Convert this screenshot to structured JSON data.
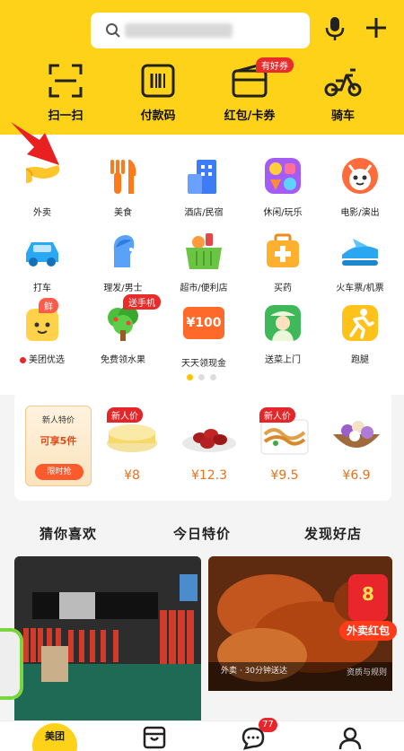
{
  "header": {
    "city": "",
    "quick_actions": [
      {
        "label": "扫一扫",
        "icon": "scan-icon"
      },
      {
        "label": "付款码",
        "icon": "barcode-icon"
      },
      {
        "label": "红包/卡券",
        "icon": "wallet-icon",
        "badge": "有好券"
      },
      {
        "label": "骑车",
        "icon": "scooter-icon"
      }
    ]
  },
  "grid": [
    {
      "label": "外卖",
      "icon": "takeout-icon"
    },
    {
      "label": "美食",
      "icon": "food-icon"
    },
    {
      "label": "酒店/民宿",
      "icon": "hotel-icon"
    },
    {
      "label": "休闲/玩乐",
      "icon": "leisure-icon"
    },
    {
      "label": "电影/演出",
      "icon": "movie-icon"
    },
    {
      "label": "打车",
      "icon": "taxi-icon"
    },
    {
      "label": "理发/男士",
      "icon": "barber-icon"
    },
    {
      "label": "超市/便利店",
      "icon": "supermarket-icon"
    },
    {
      "label": "买药",
      "icon": "medicine-icon"
    },
    {
      "label": "火车票/机票",
      "icon": "train-plane-icon"
    },
    {
      "label": "美团优选",
      "icon": "youxuan-icon",
      "badge": "鲜"
    },
    {
      "label": "免费领水果",
      "icon": "fruit-tree-icon",
      "badge": "送手机"
    },
    {
      "label": "天天领现金",
      "icon": "cash-icon",
      "badge_text": "¥100"
    },
    {
      "label": "送菜上门",
      "icon": "grocery-delivery-icon"
    },
    {
      "label": "跑腿",
      "icon": "errand-icon"
    }
  ],
  "promo": {
    "card": {
      "title": "新人特价",
      "subtitle": "可享5件",
      "button": "限时抢"
    },
    "items": [
      {
        "price": "¥8",
        "tag": "新人价",
        "icon": "cake-icon"
      },
      {
        "price": "¥12.3",
        "tag": "",
        "icon": "dates-icon"
      },
      {
        "price": "¥9.5",
        "tag": "新人价",
        "icon": "noodles-icon"
      },
      {
        "price": "¥6.9",
        "tag": "",
        "icon": "taro-icon"
      }
    ]
  },
  "tabs": [
    "猜你喜欢",
    "今日特价",
    "发现好店"
  ],
  "feed": {
    "caption": "外卖 · 30分钟送达",
    "caption_right": "资质与规则",
    "redpack_amount": "8",
    "redpack_label": "外卖红包"
  },
  "bottom": {
    "home_label": "美团",
    "message_badge": "77"
  },
  "colors": {
    "brand": "#ffd21a",
    "accent_red": "#e8262c",
    "price": "#e8711a"
  }
}
